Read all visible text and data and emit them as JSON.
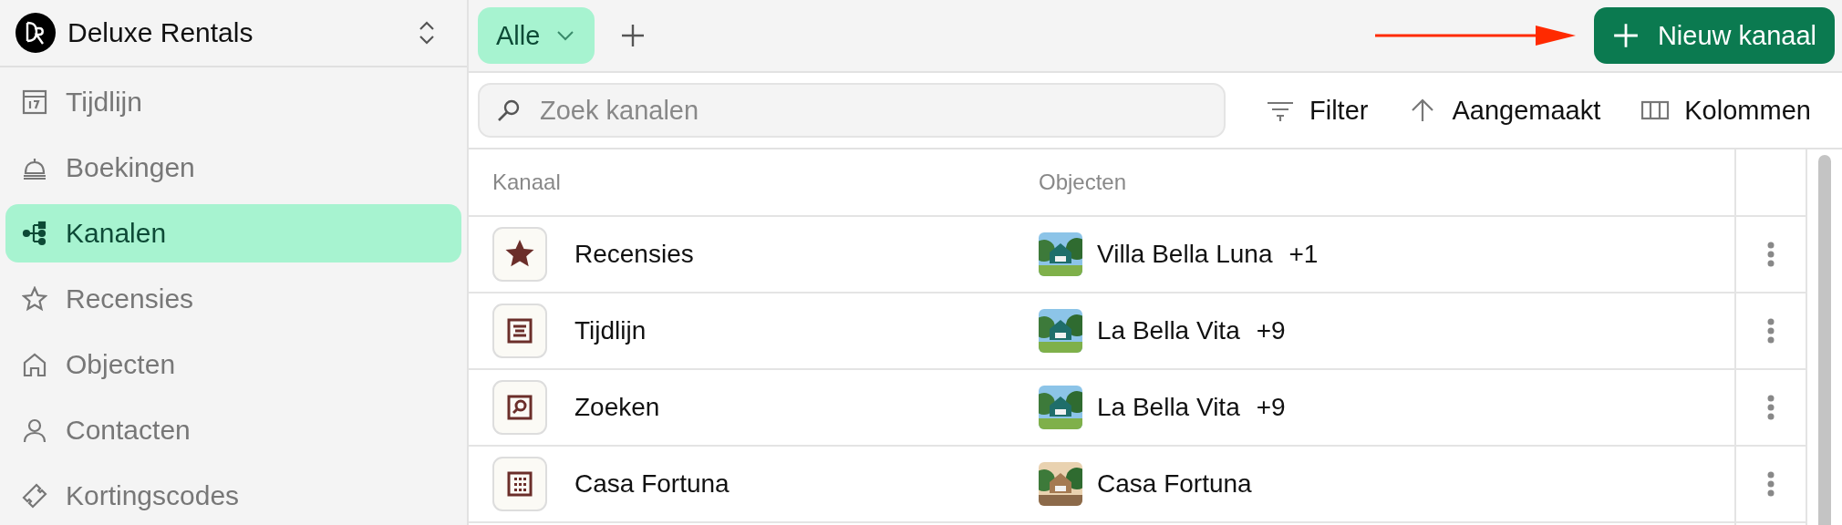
{
  "workspace": {
    "name": "Deluxe Rentals"
  },
  "sidebar": {
    "items": [
      {
        "label": "Tijdlijn",
        "kind": "calendar",
        "selected": false
      },
      {
        "label": "Boekingen",
        "kind": "bell",
        "selected": false
      },
      {
        "label": "Kanalen",
        "kind": "channels",
        "selected": true
      },
      {
        "label": "Recensies",
        "kind": "star",
        "selected": false
      },
      {
        "label": "Objecten",
        "kind": "home",
        "selected": false
      },
      {
        "label": "Contacten",
        "kind": "person",
        "selected": false
      },
      {
        "label": "Kortingscodes",
        "kind": "ticket",
        "selected": false
      }
    ]
  },
  "views": [
    {
      "label": "Alle",
      "selected": true
    }
  ],
  "new_button": "Nieuw kanaal",
  "search": {
    "placeholder": "Zoek kanalen"
  },
  "toolbar": [
    {
      "label": "Filter",
      "kind": "filter"
    },
    {
      "label": "Aangemaakt",
      "kind": "sort"
    },
    {
      "label": "Kolommen",
      "kind": "columns"
    }
  ],
  "table": {
    "columns": [
      "Kanaal",
      "Objecten"
    ],
    "rows": [
      {
        "kind": "star",
        "name": "Recensies",
        "object": "Villa Bella Luna",
        "extra": "+1"
      },
      {
        "kind": "timeline",
        "name": "Tijdlijn",
        "object": "La Bella Vita",
        "extra": "+9"
      },
      {
        "kind": "search",
        "name": "Zoeken",
        "object": "La Bella Vita",
        "extra": "+9"
      },
      {
        "kind": "grid",
        "name": "Casa Fortuna",
        "object": "Casa Fortuna"
      }
    ]
  }
}
